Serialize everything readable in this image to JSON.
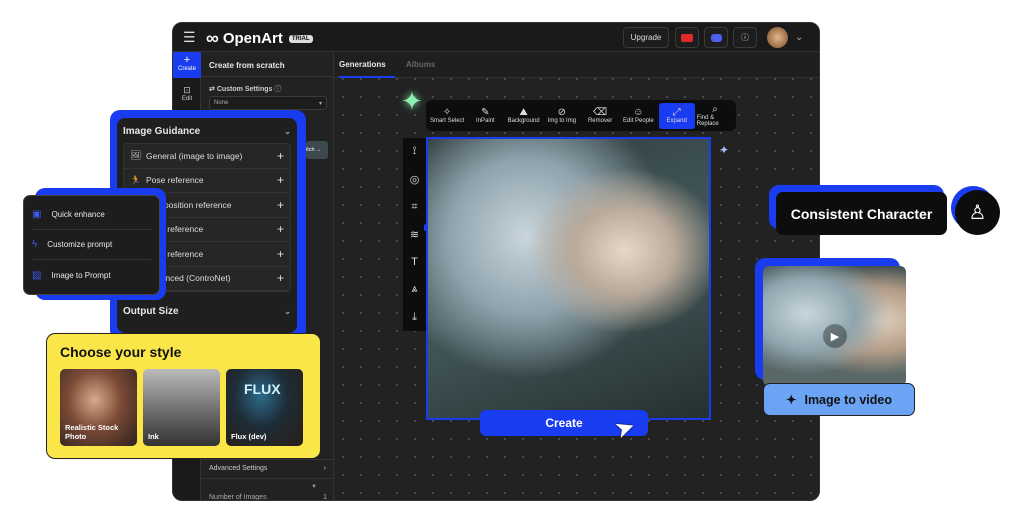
{
  "app": {
    "logo": "OpenArt",
    "badge": "TRIAL",
    "upgrade": "Upgrade"
  },
  "rail": {
    "create": "Create",
    "edit": "Edit"
  },
  "panel": {
    "title": "Create from scratch",
    "custom_settings": "Custom Settings",
    "select_value": "None",
    "switch": "itch →",
    "advanced": "Advanced Settings",
    "num_images_label": "Number of Images",
    "num_images_value": "1"
  },
  "tabs": [
    {
      "label": "Generations",
      "active": true
    },
    {
      "label": "Albums",
      "active": false
    }
  ],
  "toolbar": [
    {
      "label": "Smart Select",
      "icon": "✧"
    },
    {
      "label": "InPaint",
      "icon": "✎"
    },
    {
      "label": "Background",
      "icon": "⛰"
    },
    {
      "label": "Img to Img",
      "icon": "⊘"
    },
    {
      "label": "Remover",
      "icon": "⌫"
    },
    {
      "label": "Edit People",
      "icon": "☺"
    },
    {
      "label": "Expand",
      "icon": "⤢",
      "active": true
    },
    {
      "label": "Find & Replace",
      "icon": "⌕"
    }
  ],
  "vrail_badge": "Beta",
  "create_button": "Create",
  "image_guidance": {
    "title": "Image Guidance",
    "items": [
      "General (image to image)",
      "Pose reference",
      "Composition reference",
      "Style reference",
      "Face reference",
      "Advanced (ControNet)"
    ],
    "output_size": "Output Size"
  },
  "prompt_menu": [
    "Quick enhance",
    "Customize prompt",
    "Image to Prompt"
  ],
  "style": {
    "title": "Choose your style",
    "cards": [
      "Realistic Stock Photo",
      "Ink",
      "Flux (dev)"
    ],
    "flux_logo": "FLUX"
  },
  "consistent_character": "Consistent Character",
  "image_to_video": "Image to video",
  "colors": {
    "accent": "#1a3cf0",
    "yellow": "#fbe64a",
    "video_btn": "#6ba3f5",
    "sparkle": "#8ef0b0"
  }
}
